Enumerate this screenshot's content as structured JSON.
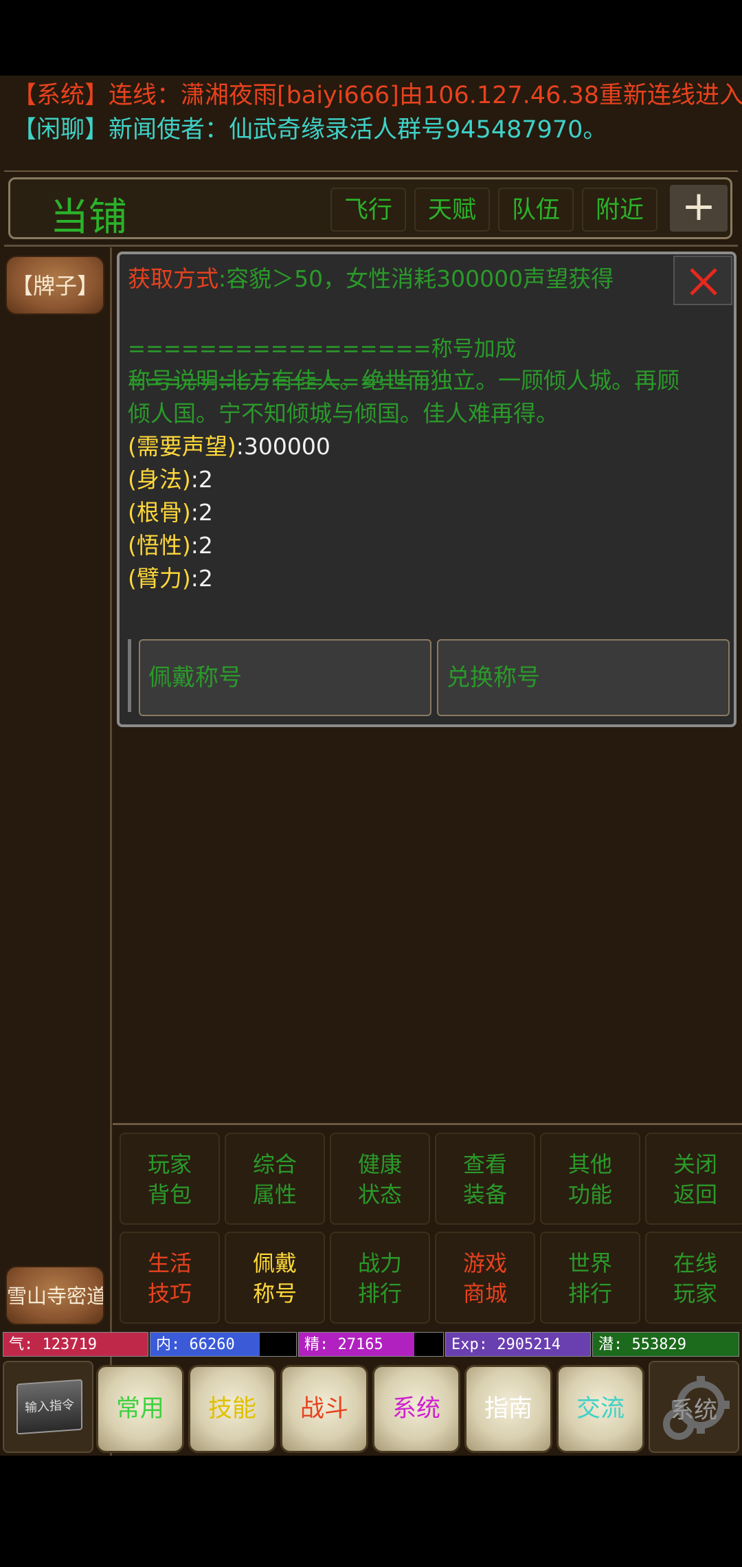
{
  "chat": {
    "line1": "【系统】连线：潇湘夜雨[baiyi666]由106.127.46.38重新连线进入",
    "line2_tag": "【闲聊】",
    "line2_msg": "新闻使者：仙武奇缘录活人群号945487970。"
  },
  "location": {
    "name": "当铺",
    "nav": [
      "飞行",
      "天赋",
      "队伍",
      "附近"
    ],
    "plus": "+"
  },
  "sidebar": {
    "top_button": "【牌子】",
    "bottom_button": "雪山寺密道"
  },
  "dialog": {
    "acquire_label": "获取方式",
    "acquire_colon": ":",
    "acquire_text": "容貌＞50，女性消耗300000声望获得",
    "section_header": "=================称号加成=================",
    "desc_line1": "称号说明:北方有佳人。绝世而独立。一顾倾人城。再顾",
    "desc_line2": "倾人国。宁不知倾城与倾国。佳人难再得。",
    "stats": [
      {
        "label": "(需要声望)",
        "value": ":300000"
      },
      {
        "label": "(身法)",
        "value": ":2"
      },
      {
        "label": "(根骨)",
        "value": ":2"
      },
      {
        "label": "(悟性)",
        "value": ":2"
      },
      {
        "label": "(臂力)",
        "value": ":2"
      }
    ],
    "wear_button": "佩戴称号",
    "exchange_button": "兑换称号"
  },
  "grid_menu": {
    "row1": [
      {
        "l1": "玩家",
        "l2": "背包",
        "color": "#2a9a2a"
      },
      {
        "l1": "综合",
        "l2": "属性",
        "color": "#2a9a2a"
      },
      {
        "l1": "健康",
        "l2": "状态",
        "color": "#2a9a2a"
      },
      {
        "l1": "查看",
        "l2": "装备",
        "color": "#2a9a2a"
      },
      {
        "l1": "其他",
        "l2": "功能",
        "color": "#2a9a2a"
      },
      {
        "l1": "关闭",
        "l2": "返回",
        "color": "#2a9a2a"
      }
    ],
    "row2": [
      {
        "l1": "生活",
        "l2": "技巧",
        "color": "#e8421e"
      },
      {
        "l1": "佩戴",
        "l2": "称号",
        "color": "#ffd83a"
      },
      {
        "l1": "战力",
        "l2": "排行",
        "color": "#2a9a2a"
      },
      {
        "l1": "游戏",
        "l2": "商城",
        "color": "#e8421e"
      },
      {
        "l1": "世界",
        "l2": "排行",
        "color": "#2a9a2a"
      },
      {
        "l1": "在线",
        "l2": "玩家",
        "color": "#2a9a2a"
      }
    ]
  },
  "stats_bar": {
    "qi": "气: 123719",
    "nei": "内: 66260",
    "jing": "精: 27165",
    "exp": "Exp: 2905214",
    "qian": "潜: 553829",
    "qi_fill": 1.0,
    "nei_fill": 0.75,
    "jing_fill": 0.8,
    "exp_fill": 1.0,
    "qian_fill": 1.0,
    "colors": {
      "qi": "#c0284a",
      "nei": "#3a5ad8",
      "jing": "#b021c0",
      "exp": "#6a3fb0",
      "qian": "#1c6a1c"
    }
  },
  "bottom_menu": {
    "input": "输入指令",
    "buttons": [
      {
        "label": "常用",
        "color": "#3fd13f"
      },
      {
        "label": "技能",
        "color": "#e0c000"
      },
      {
        "label": "战斗",
        "color": "#e8421e"
      },
      {
        "label": "系统",
        "color": "#d020d0"
      },
      {
        "label": "指南",
        "color": "#ffffff"
      },
      {
        "label": "交流",
        "color": "#3fd1c8"
      }
    ],
    "system": "系统"
  }
}
